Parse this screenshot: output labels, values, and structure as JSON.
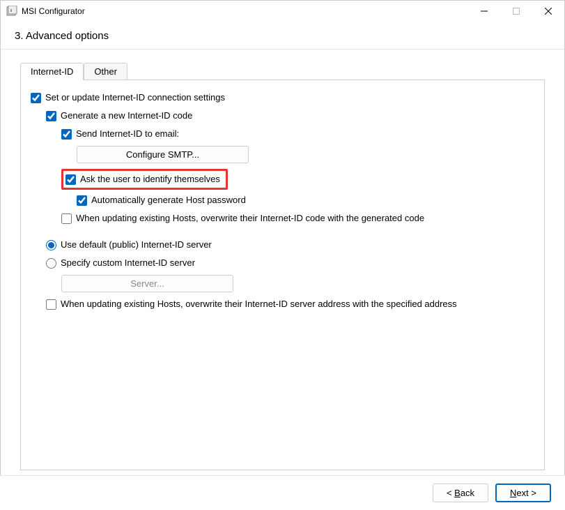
{
  "window": {
    "title": "MSI Configurator",
    "subtitle": "3. Advanced options"
  },
  "tabs": {
    "internet_id": "Internet-ID",
    "other": "Other"
  },
  "content": {
    "set_update": {
      "label": "Set or update Internet-ID connection settings",
      "checked": true
    },
    "generate_code": {
      "label": "Generate a new Internet-ID code",
      "checked": true
    },
    "send_email": {
      "label": "Send Internet-ID to email:",
      "checked": true
    },
    "configure_smtp": "Configure SMTP...",
    "ask_identify": {
      "label": "Ask the user to identify themselves",
      "checked": true
    },
    "auto_password": {
      "label": "Automatically generate Host password",
      "checked": true
    },
    "overwrite_code": {
      "label": "When updating existing Hosts, overwrite their Internet-ID code with the generated code",
      "checked": false
    },
    "use_default_server": {
      "label": "Use default (public) Internet-ID server",
      "checked": true
    },
    "specify_custom": {
      "label": "Specify custom Internet-ID server",
      "checked": false
    },
    "server_placeholder": "Server...",
    "overwrite_address": {
      "label": "When updating existing Hosts, overwrite their Internet-ID server address with the specified address",
      "checked": false
    }
  },
  "footer": {
    "back": "< Back",
    "next": "Next >"
  }
}
